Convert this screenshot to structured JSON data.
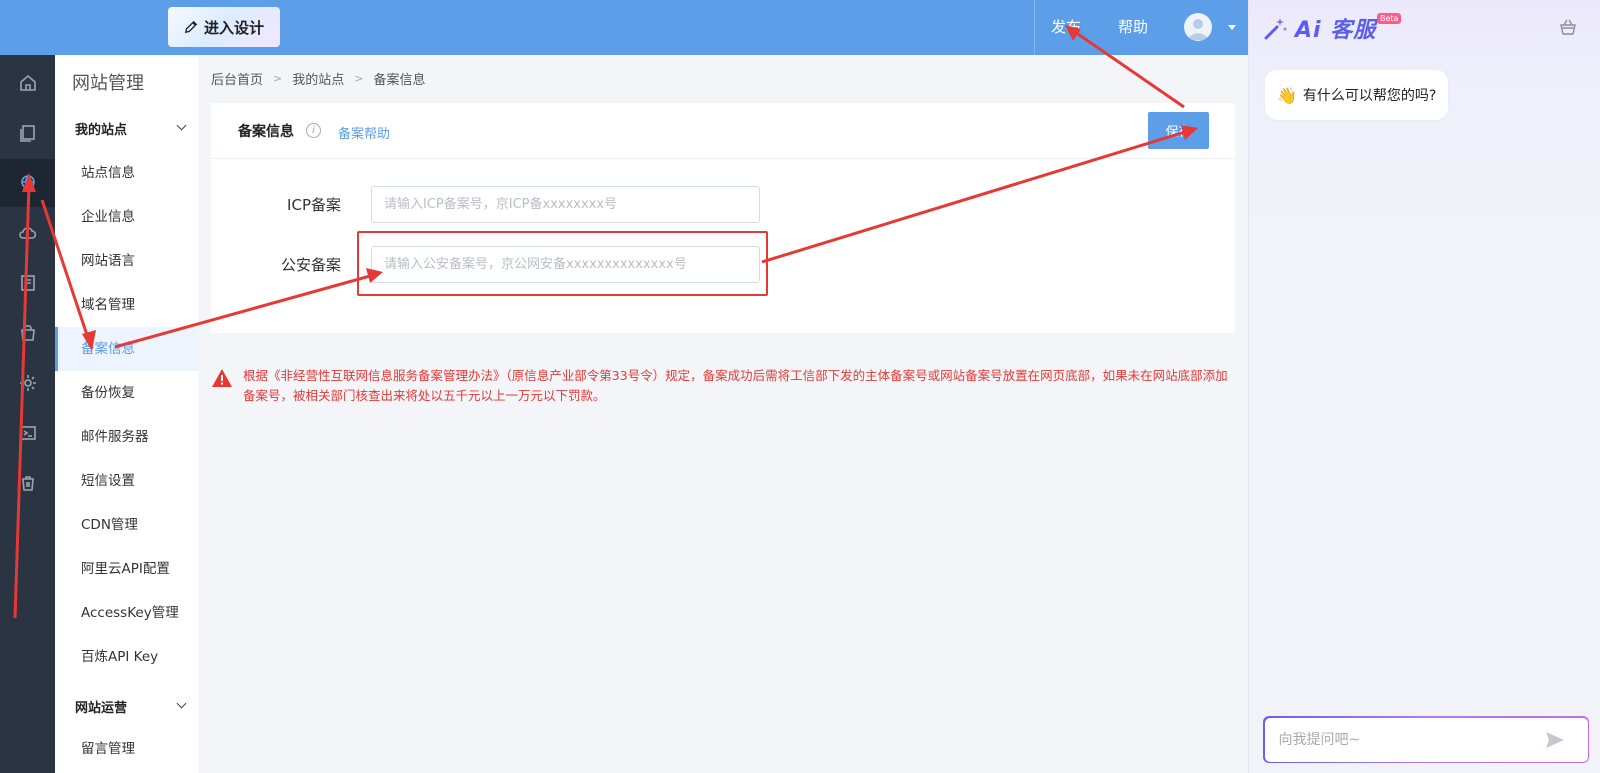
{
  "header": {
    "design_button_label": "进入设计",
    "publish_label": "发布",
    "help_label": "帮助"
  },
  "rail": {
    "icons": [
      "home-icon",
      "pages-icon",
      "site-icon",
      "cloud-icon",
      "book-icon",
      "bag-icon",
      "gear-icon",
      "terminal-icon",
      "trash-icon"
    ],
    "active_index": 2
  },
  "submenu": {
    "title": "网站管理",
    "group_my_sites": "我的站点",
    "items": [
      "站点信息",
      "企业信息",
      "网站语言",
      "域名管理",
      "备案信息",
      "备份恢复",
      "邮件服务器",
      "短信设置",
      "CDN管理",
      "阿里云API配置",
      "AccessKey管理",
      "百炼API Key"
    ],
    "active_item": "备案信息",
    "group_operations": "网站运营",
    "ops_items": [
      "留言管理"
    ]
  },
  "breadcrumb": [
    "后台首页",
    "我的站点",
    "备案信息"
  ],
  "card": {
    "title": "备案信息",
    "help_link": "备案帮助",
    "save_label": "保存",
    "icp_label": "ICP备案",
    "icp_placeholder": "请输入ICP备案号，京ICP备xxxxxxxx号",
    "police_label": "公安备案",
    "police_placeholder": "请输入公安备案号，京公网安备xxxxxxxxxxxxxx号"
  },
  "warning": {
    "text": "根据《非经营性互联网信息服务备案管理办法》（原信息产业部令第33号令）规定，备案成功后需将工信部下发的主体备案号或网站备案号放置在网页底部，如果未在网站底部添加备案号，被相关部门核查出来将处以五千元以上一万元以下罚款。"
  },
  "chat": {
    "brand": "Ai 客服",
    "beta": "Beta",
    "greeting": "有什么可以帮您的吗?",
    "input_placeholder": "向我提问吧~"
  },
  "colors": {
    "primary": "#5c9ee8",
    "rail_bg": "#2b3443",
    "annotation_red": "#e53935",
    "chat_accent": "#5b5df0"
  }
}
